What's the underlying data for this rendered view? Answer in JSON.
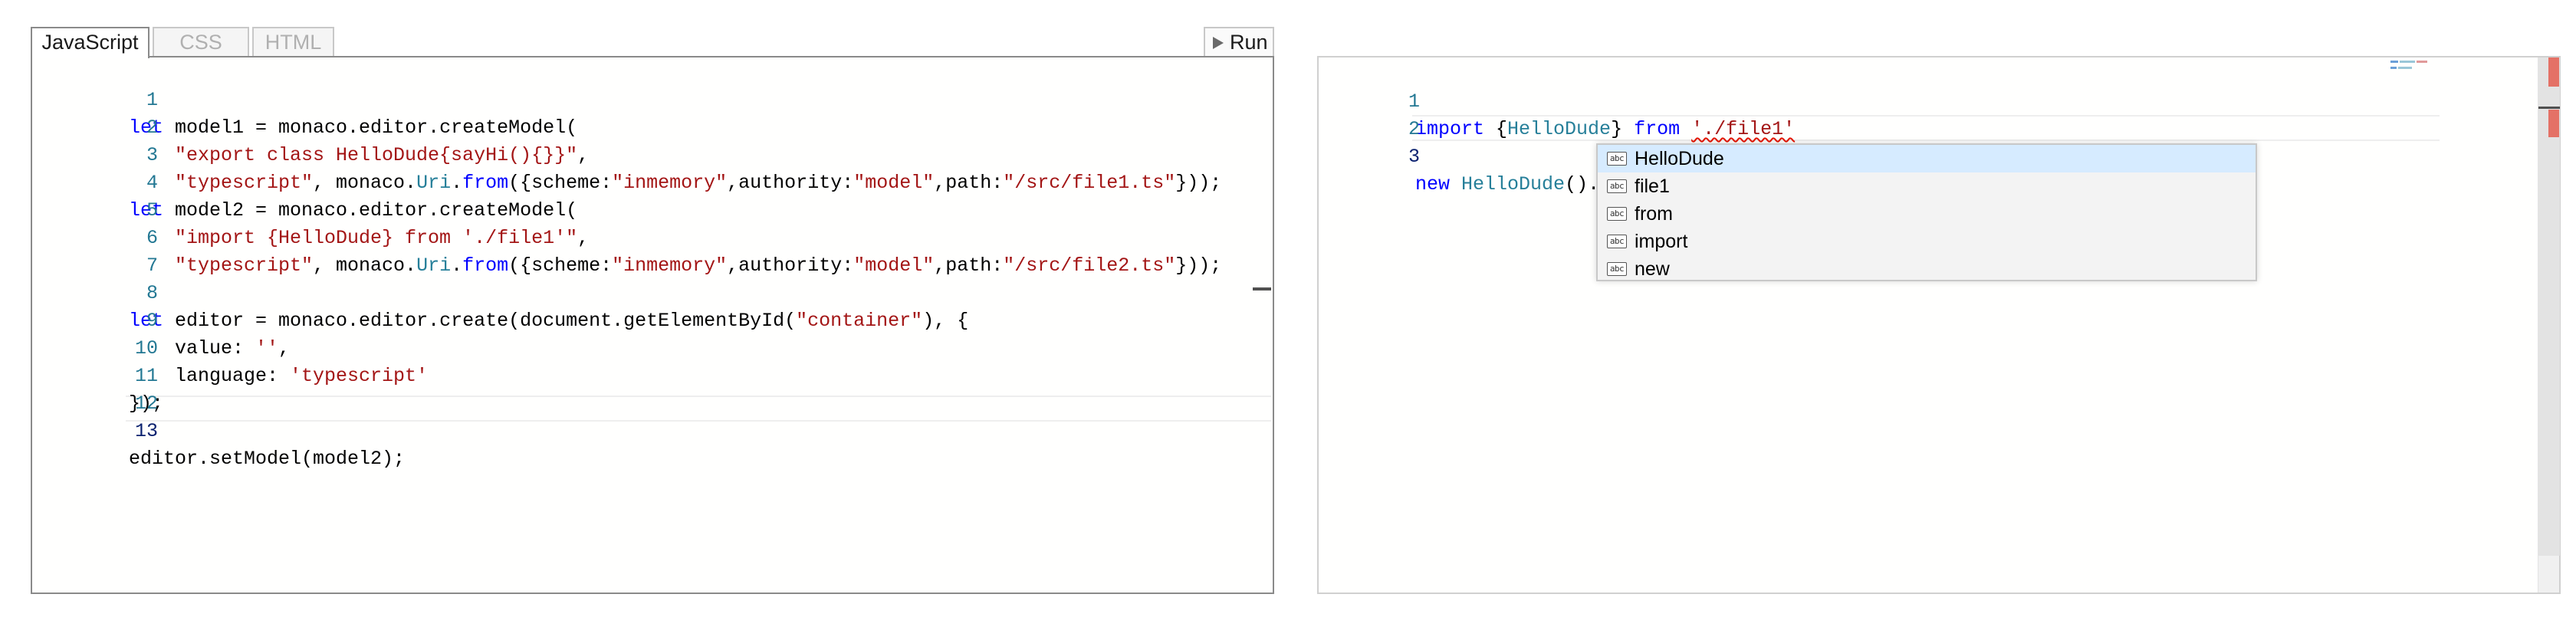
{
  "left": {
    "tabs": [
      {
        "label": "JavaScript",
        "active": true
      },
      {
        "label": "CSS",
        "active": false
      },
      {
        "label": "HTML",
        "active": false
      }
    ],
    "run_label": "Run",
    "line_numbers": [
      "1",
      "2",
      "3",
      "4",
      "5",
      "6",
      "7",
      "8",
      "9",
      "10",
      "11",
      "12",
      "13"
    ],
    "code": {
      "l1a": "let",
      "l1b": " model1 = monaco.editor.createModel(",
      "l2": "\"export class HelloDude{sayHi(){}}\"",
      "l2b": ",",
      "l3a": "\"typescript\"",
      "l3b": ", monaco.",
      "l3c": "Uri",
      "l3d": ".",
      "l3e": "from",
      "l3f": "({scheme:",
      "l3g": "\"inmemory\"",
      "l3h": ",authority:",
      "l3i": "\"model\"",
      "l3j": ",path:",
      "l3k": "\"/src/file1.ts\"",
      "l3l": "}));",
      "l4a": "let",
      "l4b": " model2 = monaco.editor.createModel(",
      "l5": "\"import {HelloDude} from './file1'\"",
      "l5b": ",",
      "l6a": "\"typescript\"",
      "l6b": ", monaco.",
      "l6c": "Uri",
      "l6d": ".",
      "l6e": "from",
      "l6f": "({scheme:",
      "l6g": "\"inmemory\"",
      "l6h": ",authority:",
      "l6i": "\"model\"",
      "l6j": ",path:",
      "l6k": "\"/src/file2.ts\"",
      "l6l": "}));",
      "l8a": "let",
      "l8b": " editor = monaco.editor.create(document.getElementById(",
      "l8c": "\"container\"",
      "l8d": "), {",
      "l9a": "value: ",
      "l9b": "''",
      "l9c": ",",
      "l10a": "language: ",
      "l10b": "'typescript'",
      "l11": "});",
      "l13": "editor.setModel(model2);"
    }
  },
  "right": {
    "line_numbers": [
      "1",
      "2",
      "3"
    ],
    "code": {
      "r1a": "import",
      "r1b": " {",
      "r1c": "HelloDude",
      "r1d": "} ",
      "r1e": "from",
      "r1f": " ",
      "r1g": "'./file1'",
      "r3a": "new",
      "r3b": " ",
      "r3c": "HelloDude",
      "r3d": "()."
    },
    "suggestions": [
      {
        "label": "HelloDude",
        "icon": "abc",
        "selected": true
      },
      {
        "label": "file1",
        "icon": "abc",
        "selected": false
      },
      {
        "label": "from",
        "icon": "abc",
        "selected": false
      },
      {
        "label": "import",
        "icon": "abc",
        "selected": false
      },
      {
        "label": "new",
        "icon": "abc",
        "selected": false
      }
    ]
  },
  "colors": {
    "keyword": "#0000ff",
    "string": "#a31515",
    "type": "#267f99",
    "line_number": "#237893",
    "suggest_selected": "#d6ebff",
    "error": "#e51400"
  }
}
